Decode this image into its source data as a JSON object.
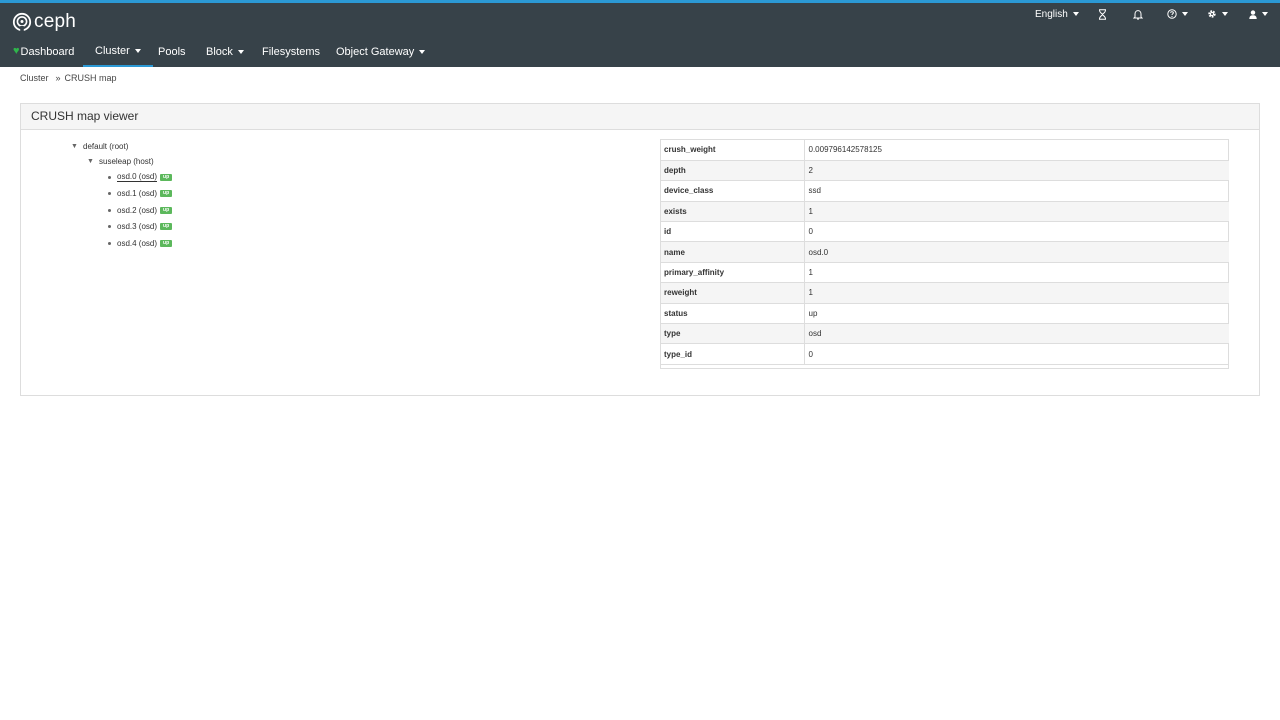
{
  "header": {
    "brand": "ceph",
    "language": "English",
    "utility_icons": [
      "hourglass-icon",
      "bell-icon",
      "help-icon",
      "gear-icon",
      "user-icon"
    ]
  },
  "nav": {
    "items": [
      {
        "label": "Dashboard",
        "icon": "heart-icon",
        "has_dropdown": false
      },
      {
        "label": "Cluster",
        "has_dropdown": true,
        "active": true
      },
      {
        "label": "Pools",
        "has_dropdown": false
      },
      {
        "label": "Block",
        "has_dropdown": true
      },
      {
        "label": "Filesystems",
        "has_dropdown": false
      },
      {
        "label": "Object Gateway",
        "has_dropdown": true
      }
    ]
  },
  "breadcrumb": {
    "parent": "Cluster",
    "current": "CRUSH map"
  },
  "panel": {
    "title": "CRUSH map viewer"
  },
  "tree": {
    "root": "default (root)",
    "host": "suseleap (host)",
    "osds": [
      {
        "label": "osd.0 (osd)",
        "status": "up",
        "selected": true
      },
      {
        "label": "osd.1 (osd)",
        "status": "up"
      },
      {
        "label": "osd.2 (osd)",
        "status": "up"
      },
      {
        "label": "osd.3 (osd)",
        "status": "up"
      },
      {
        "label": "osd.4 (osd)",
        "status": "up"
      }
    ]
  },
  "details": [
    {
      "key": "crush_weight",
      "value": "0.009796142578125"
    },
    {
      "key": "depth",
      "value": "2"
    },
    {
      "key": "device_class",
      "value": "ssd"
    },
    {
      "key": "exists",
      "value": "1"
    },
    {
      "key": "id",
      "value": "0"
    },
    {
      "key": "name",
      "value": "osd.0"
    },
    {
      "key": "primary_affinity",
      "value": "1"
    },
    {
      "key": "reweight",
      "value": "1"
    },
    {
      "key": "status",
      "value": "up"
    },
    {
      "key": "type",
      "value": "osd"
    },
    {
      "key": "type_id",
      "value": "0"
    }
  ],
  "colors": {
    "header_bg": "#374249",
    "accent": "#2b99d5",
    "health_green": "#2fb64b",
    "badge_up": "#5cb85c"
  }
}
